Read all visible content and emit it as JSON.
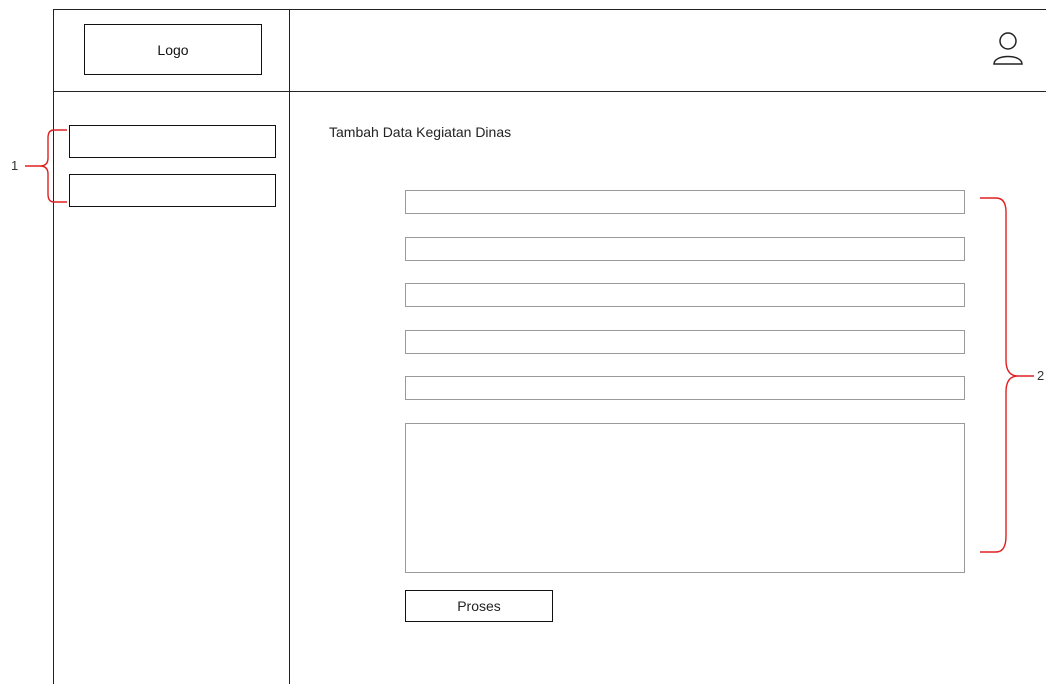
{
  "header": {
    "logo_label": "Logo",
    "user_icon": "user-icon"
  },
  "sidebar": {
    "items": [
      {
        "label": ""
      },
      {
        "label": ""
      }
    ]
  },
  "main": {
    "title": "Tambah Data Kegiatan Dinas",
    "fields": [
      {
        "value": "",
        "placeholder": ""
      },
      {
        "value": "",
        "placeholder": ""
      },
      {
        "value": "",
        "placeholder": ""
      },
      {
        "value": "",
        "placeholder": ""
      },
      {
        "value": "",
        "placeholder": ""
      }
    ],
    "textarea": {
      "value": "",
      "placeholder": ""
    },
    "submit_label": "Proses"
  },
  "annotations": {
    "sidebar_marker": "1",
    "form_marker": "2",
    "bracket_color": "#e02020"
  }
}
